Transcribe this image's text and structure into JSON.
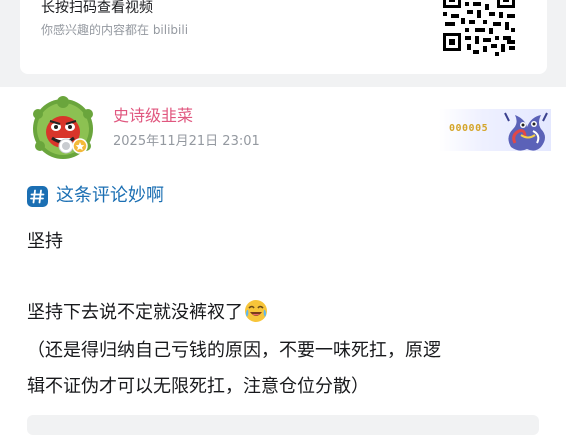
{
  "share_card": {
    "title": "长按扫码查看视频",
    "subtitle": "你感兴趣的内容都在 bilibili"
  },
  "comment": {
    "username": "史诗级韭菜",
    "timestamp": "2025年11月21日 23:01",
    "fan_badge_number": "000005",
    "topic": "这条评论妙啊",
    "lines": [
      "坚持",
      "坚持下去说不定就没裤衩了",
      "（还是得归纳自己亏钱的原因，不要一味死扛，原逻",
      "辑不证伪才可以无限死扛，注意仓位分散）"
    ],
    "emoji": "crying-laughing-emoji"
  },
  "colors": {
    "username": "#e0577f",
    "topic": "#1b6fb3",
    "fan_number": "#d4a52a",
    "page_gray": "#f1f2f3"
  }
}
